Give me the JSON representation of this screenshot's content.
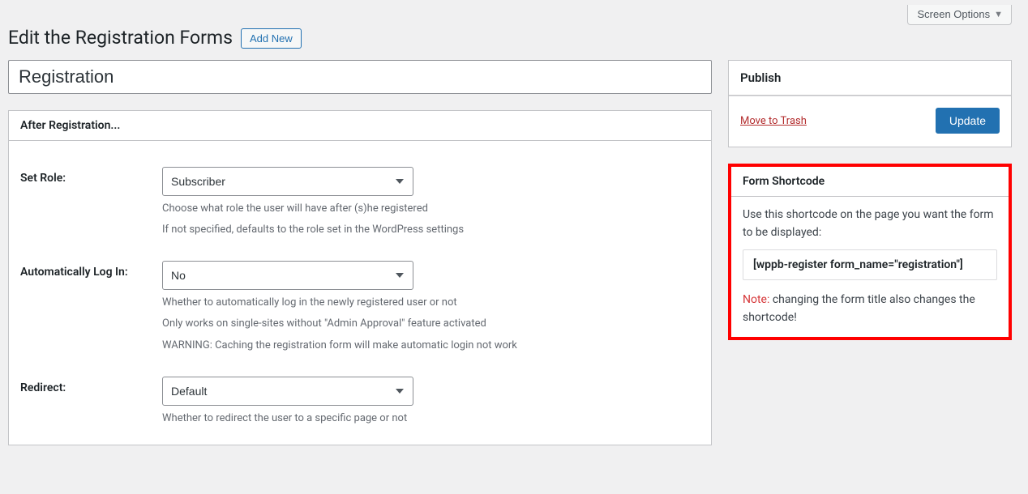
{
  "screenOptions": "Screen Options",
  "pageTitle": "Edit the Registration Forms",
  "addNew": "Add New",
  "formTitle": "Registration",
  "afterReg": {
    "heading": "After Registration...",
    "setRole": {
      "label": "Set Role:",
      "value": "Subscriber",
      "desc1": "Choose what role the user will have after (s)he registered",
      "desc2": "If not specified, defaults to the role set in the WordPress settings"
    },
    "autoLogin": {
      "label": "Automatically Log In:",
      "value": "No",
      "desc1": "Whether to automatically log in the newly registered user or not",
      "desc2": "Only works on single-sites without \"Admin Approval\" feature activated",
      "desc3": "WARNING: Caching the registration form will make automatic login not work"
    },
    "redirect": {
      "label": "Redirect:",
      "value": "Default",
      "desc1": "Whether to redirect the user to a specific page or not"
    }
  },
  "publish": {
    "heading": "Publish",
    "trash": "Move to Trash",
    "update": "Update"
  },
  "shortcode": {
    "heading": "Form Shortcode",
    "intro": "Use this shortcode on the page you want the form to be displayed:",
    "code": "[wppb-register form_name=\"registration\"]",
    "noteLabel": "Note:",
    "noteText": " changing the form title also changes the shortcode!"
  }
}
